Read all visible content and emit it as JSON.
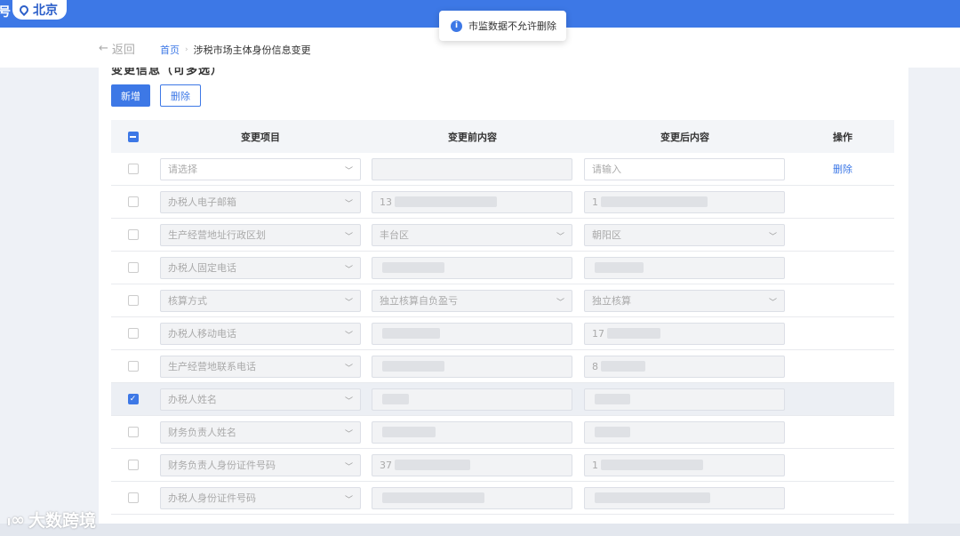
{
  "header": {
    "edge_char": "号",
    "city": "北京"
  },
  "toast": {
    "message": "市监数据不允许删除"
  },
  "breadcrumb": {
    "back_label": "返回",
    "home": "首页",
    "current": "涉税市场主体身份信息变更"
  },
  "section": {
    "cut_title": "变更信息（可多选）"
  },
  "toolbar": {
    "add_label": "新增",
    "delete_label": "删除"
  },
  "table": {
    "headers": {
      "item": "变更项目",
      "before": "变更前内容",
      "after": "变更后内容",
      "op": "操作"
    },
    "first_row": {
      "item_placeholder": "请选择",
      "after_placeholder": "请输入",
      "op": "删除"
    },
    "rows": [
      {
        "item": "办税人电子邮箱",
        "before": "13",
        "after": "1",
        "selected": false
      },
      {
        "item": "生产经营地址行政区划",
        "before": "丰台区",
        "after": "朝阳区",
        "selected": false
      },
      {
        "item": "办税人固定电话",
        "before": "",
        "after": "",
        "selected": false
      },
      {
        "item": "核算方式",
        "before": "独立核算自负盈亏",
        "after": "独立核算",
        "selected": false
      },
      {
        "item": "办税人移动电话",
        "before": "",
        "after": "17",
        "selected": false
      },
      {
        "item": "生产经营地联系电话",
        "before": "",
        "after": "8",
        "selected": false
      },
      {
        "item": "办税人姓名",
        "before": "",
        "after": "",
        "selected": true
      },
      {
        "item": "财务负责人姓名",
        "before": "",
        "after": "",
        "selected": false
      },
      {
        "item": "财务负责人身份证件号码",
        "before": "37",
        "after": "1",
        "selected": false
      },
      {
        "item": "办税人身份证件号码",
        "before": "",
        "after": "",
        "selected": false
      }
    ]
  },
  "watermark": {
    "text": "大数跨境"
  },
  "colors": {
    "primary": "#3d78e6",
    "page_bg": "#eef1f6"
  }
}
